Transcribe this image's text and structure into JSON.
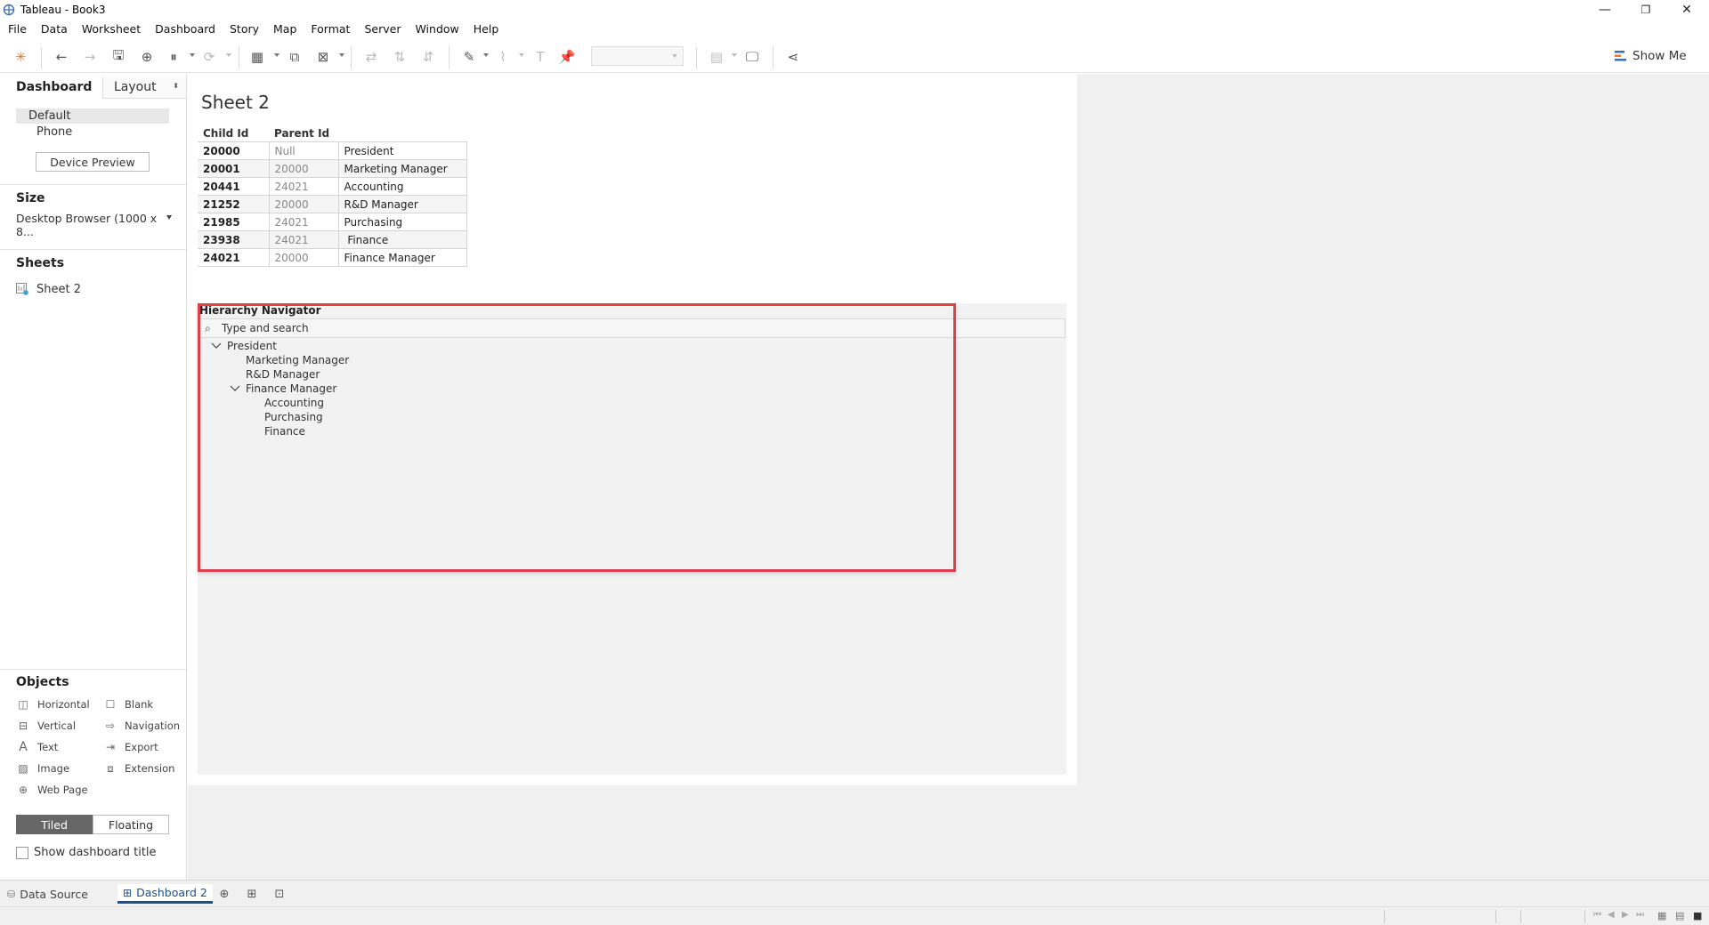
{
  "window": {
    "title": "Tableau - Book3",
    "minimize": "—",
    "restore": "❐",
    "close": "✕"
  },
  "menu": [
    "File",
    "Data",
    "Worksheet",
    "Dashboard",
    "Story",
    "Map",
    "Format",
    "Server",
    "Window",
    "Help"
  ],
  "toolbar": {
    "show_me": "Show Me"
  },
  "left_pane": {
    "tab_dashboard": "Dashboard",
    "tab_layout": "Layout",
    "devices": [
      "Default",
      "Phone"
    ],
    "device_preview": "Device Preview",
    "size_title": "Size",
    "size_value": "Desktop Browser (1000 x 8...",
    "sheets_title": "Sheets",
    "sheets": [
      "Sheet 2"
    ],
    "objects_title": "Objects",
    "objects": {
      "horizontal": "Horizontal",
      "blank": "Blank",
      "vertical": "Vertical",
      "navigation": "Navigation",
      "text": "Text",
      "export": "Export",
      "image": "Image",
      "extension": "Extension",
      "web_page": "Web Page"
    },
    "tiled": "Tiled",
    "floating": "Floating",
    "show_dashboard_title": "Show dashboard title"
  },
  "sheet": {
    "title": "Sheet 2",
    "columns": [
      "Child Id",
      "Parent Id"
    ],
    "rows": [
      {
        "child": "20000",
        "parent": "Null",
        "role": "President"
      },
      {
        "child": "20001",
        "parent": "20000",
        "role": "Marketing Manager"
      },
      {
        "child": "20441",
        "parent": "24021",
        "role": "Accounting"
      },
      {
        "child": "21252",
        "parent": "20000",
        "role": "R&D Manager"
      },
      {
        "child": "21985",
        "parent": "24021",
        "role": "Purchasing"
      },
      {
        "child": "23938",
        "parent": "24021",
        "role": " Finance"
      },
      {
        "child": "24021",
        "parent": "20000",
        "role": "Finance Manager"
      }
    ]
  },
  "extension": {
    "title": "Hierarchy Navigator",
    "search_placeholder": "Type and search",
    "tree": {
      "root": "President",
      "children": [
        "Marketing Manager",
        "R&D Manager",
        "Finance Manager"
      ],
      "grandchildren": [
        "Accounting",
        "Purchasing",
        "Finance"
      ]
    },
    "highlight_color": "#e0404a"
  },
  "bottom_tabs": {
    "data_source": "Data Source",
    "dashboard": "Dashboard 2"
  }
}
